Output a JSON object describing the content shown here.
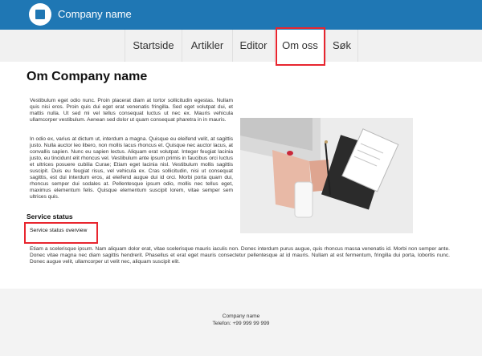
{
  "header": {
    "brand": "Company name",
    "logo_icon": "square-in-circle-icon",
    "bar_color": "#1f77b4"
  },
  "nav": {
    "items": [
      {
        "label": "Startside"
      },
      {
        "label": "Artikler"
      },
      {
        "label": "Editor"
      },
      {
        "label": "Om oss",
        "active": true
      },
      {
        "label": "Søk"
      }
    ]
  },
  "main": {
    "title": "Om Company name",
    "paragraph1": "Vestibulum eget odio nunc. Proin placerat diam at tortor sollicitudin egestas. Nullam quis nisi eros. Proin quis dui eget erat venenatis fringilla. Sed eget volutpat dui, et mattis nulla. Ut sed mi vel tellus consequat luctus ut nec ex. Mauris vehicula ullamcorper vestibulum. Aenean sed dolor ut quam consequat pharetra in in mauris.",
    "paragraph2": "In odio ex, varius at dictum ut, interdum a magna. Quisque eu eleifend velit, at sagittis justo. Nulla auctor leo libero, non mollis lacus rhoncus et. Quisque nec auctor lacus, at convallis sapien. Nunc eu sapien lectus. Aliquam erat volutpat. Integer feugiat lacinia justo, eu tincidunt elit rhoncus vel. Vestibulum ante ipsum primis in faucibus orci luctus et ultrices posuere cubilia Curae; Etiam eget lacinia nisl. Vestibulum mollis sagittis suscipit. Duis eu feugiat risus, vel vehicula ex. Cras sollicitudin, nisi ut consequat sagittis, est dui interdum eros, at eleifend augue dui id orci. Morbi porta quam dui, rhoncus semper dui sodales at. Pellentesque ipsum odio, mollis nec tellus eget, maximus elementum felis. Quisque elementum suscipit lorem, vitae semper sem ultrices quis.",
    "service_status_heading": "Service status",
    "service_status_link": "Service status overview",
    "paragraph3": "Etiam a scelerisque ipsum. Nam aliquam dolor erat, vitae scelerisque mauris iaculis non. Donec interdum purus augue, quis rhoncus massa venenatis id. Morbi non semper ante. Donec vitae magna nec diam sagittis hendrerit. Phasellus et erat eget mauris consectetur pellentesque at id mauris. Nullam at est fermentum, fringilla dui porta, lobortis nunc. Donec augue velit, ullamcorper ut velit nec, aliquam suscipit elit."
  },
  "footer": {
    "company": "Company name",
    "phone": "Telefon: +99 999 99 999"
  },
  "colors": {
    "highlight": "#e8262f"
  }
}
